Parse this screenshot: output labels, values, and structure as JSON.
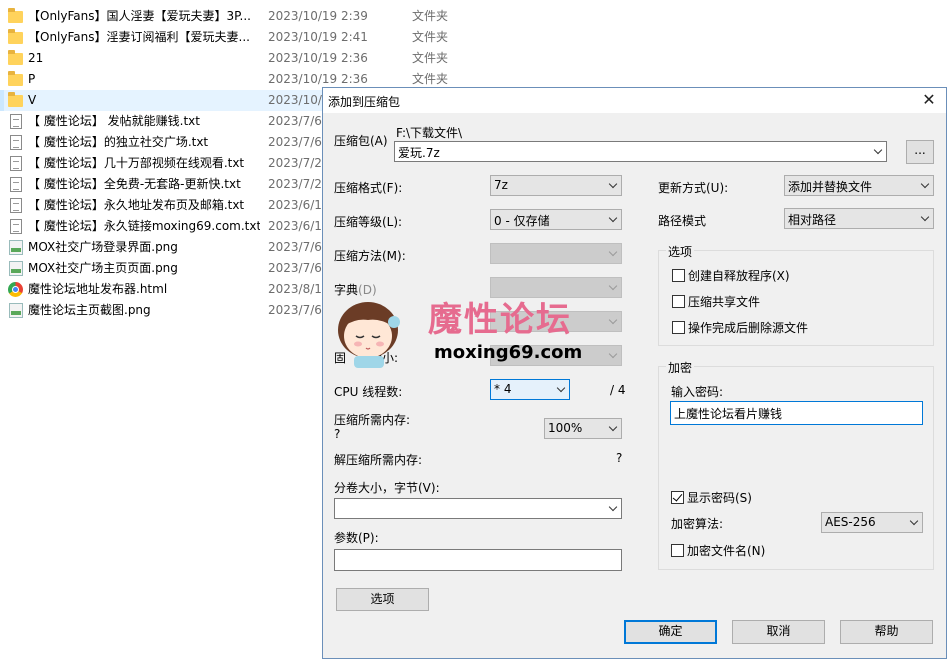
{
  "explorer": {
    "files": [
      {
        "name": "【OnlyFans】国人淫妻【爱玩夫妻】3P...",
        "date": "2023/10/19 2:39",
        "type": "文件夹",
        "icon": "folder-icon",
        "selected": false
      },
      {
        "name": "【OnlyFans】淫妻订阅福利【爱玩夫妻...",
        "date": "2023/10/19 2:41",
        "type": "文件夹",
        "icon": "folder-icon",
        "selected": false
      },
      {
        "name": "21",
        "date": "2023/10/19 2:36",
        "type": "文件夹",
        "icon": "folder-icon",
        "selected": false
      },
      {
        "name": "P",
        "date": "2023/10/19 2:36",
        "type": "文件夹",
        "icon": "folder-icon",
        "selected": false
      },
      {
        "name": "V",
        "date": "2023/10/",
        "type": "",
        "icon": "folder-icon",
        "selected": true
      },
      {
        "name": "【 魔性论坛】 发帖就能赚钱.txt",
        "date": "2023/7/6",
        "type": "",
        "icon": "txt-file-icon",
        "selected": false
      },
      {
        "name": "【 魔性论坛】的独立社交广场.txt",
        "date": "2023/7/6",
        "type": "",
        "icon": "txt-file-icon",
        "selected": false
      },
      {
        "name": "【 魔性论坛】几十万部视频在线观看.txt",
        "date": "2023/7/2",
        "type": "",
        "icon": "txt-file-icon",
        "selected": false
      },
      {
        "name": "【 魔性论坛】全免费-无套路-更新快.txt",
        "date": "2023/7/2",
        "type": "",
        "icon": "txt-file-icon",
        "selected": false
      },
      {
        "name": "【 魔性论坛】永久地址发布页及邮箱.txt",
        "date": "2023/6/1",
        "type": "",
        "icon": "txt-file-icon",
        "selected": false
      },
      {
        "name": "【 魔性论坛】永久链接moxing69.com.txt",
        "date": "2023/6/1",
        "type": "",
        "icon": "txt-file-icon",
        "selected": false
      },
      {
        "name": "MOX社交广场登录界面.png",
        "date": "2023/7/6",
        "type": "",
        "icon": "png-file-icon",
        "selected": false
      },
      {
        "name": "MOX社交广场主页页面.png",
        "date": "2023/7/6",
        "type": "",
        "icon": "png-file-icon",
        "selected": false
      },
      {
        "name": "魔性论坛地址发布器.html",
        "date": "2023/8/1",
        "type": "",
        "icon": "html-file-icon",
        "selected": false
      },
      {
        "name": "魔性论坛主页截图.png",
        "date": "2023/7/6",
        "type": "",
        "icon": "png-file-icon",
        "selected": false
      }
    ]
  },
  "dialog": {
    "title": "添加到压缩包",
    "archive_label": "压缩包(A)",
    "archive_path": "F:\\下载文件\\",
    "archive_name": "爱玩.7z",
    "browse_label": "...",
    "format_label": "压缩格式(F):",
    "format_value": "7z",
    "level_label": "压缩等级(L):",
    "level_value": "0 - 仅存储",
    "method_label": "压缩方法(M):",
    "dict_label": "字典",
    "dict_suffix": "(D)",
    "solid_label_a": "固",
    "solid_label_b": "大小:",
    "threads_label": "CPU 线程数:",
    "threads_value": "* 4",
    "threads_total": "/ 4",
    "mem_label": "压缩所需内存:",
    "mem_value": "?",
    "mem_percent": "100%",
    "decomp_mem_label": "解压缩所需内存:",
    "decomp_mem_value": "?",
    "split_label": "分卷大小，字节(V):",
    "split_value": "",
    "params_label": "参数(P):",
    "params_value": "",
    "options_button": "选项",
    "update_label": "更新方式(U):",
    "update_value": "添加并替换文件",
    "pathmode_label": "路径模式",
    "pathmode_value": "相对路径",
    "options_group": "选项",
    "opt_sfx": "创建自释放程序(X)",
    "opt_shared": "压缩共享文件",
    "opt_delete": "操作完成后删除源文件",
    "encrypt_group": "加密",
    "password_label": "输入密码:",
    "password_value": "上魔性论坛看片赚钱",
    "show_password": "显示密码(S)",
    "enc_method_label": "加密算法:",
    "enc_method_value": "AES-256",
    "enc_filenames": "加密文件名(N)",
    "ok": "确定",
    "cancel": "取消",
    "help": "帮助"
  },
  "watermark": {
    "title": "魔性论坛",
    "url": "moxing69.com"
  },
  "colors": {
    "selection": "#cce8ff",
    "accent": "#0078d7",
    "dialog_bg": "#f0f0f0",
    "watermark_pink": "#e66b8f"
  }
}
